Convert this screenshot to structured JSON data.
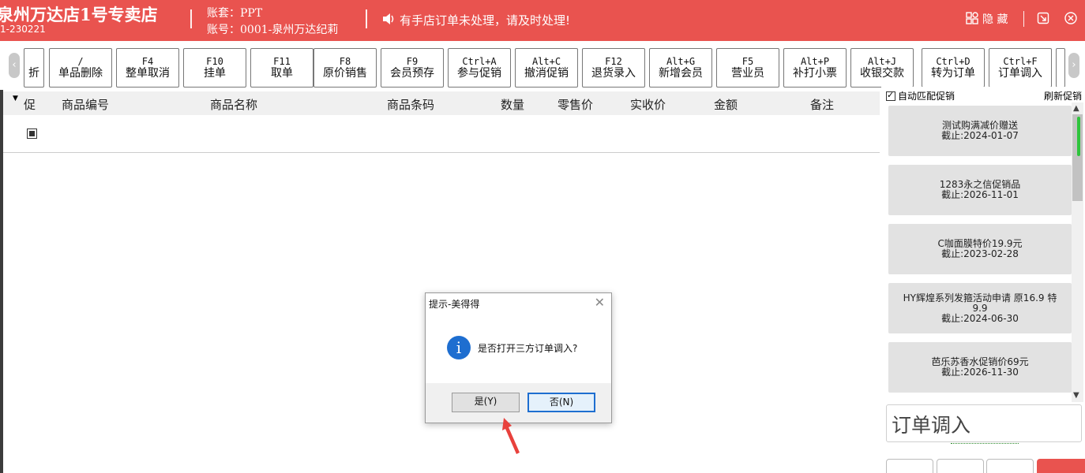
{
  "header": {
    "store_name": "泉州万达店1号专卖店",
    "store_code": "1-230221",
    "account_set": "账套：PPT",
    "account_no": "账号：0001-泉州万达纪莉",
    "notice": "有手店订单未处理，请及时处理!",
    "right_label": "隐 藏"
  },
  "toolbar": {
    "buttons": [
      {
        "key": "",
        "label": "折"
      },
      {
        "key": "/",
        "label": "单品删除"
      },
      {
        "key": "F4",
        "label": "整单取消"
      },
      {
        "key": "F10",
        "label": "挂单"
      },
      {
        "key": "F11",
        "label": "取单"
      },
      {
        "key": "F8",
        "label": "原价销售"
      },
      {
        "key": "F9",
        "label": "会员预存"
      },
      {
        "key": "Ctrl+A",
        "label": "参与促销"
      },
      {
        "key": "Alt+C",
        "label": "撤消促销"
      },
      {
        "key": "F12",
        "label": "退货录入"
      },
      {
        "key": "Alt+G",
        "label": "新增会员"
      },
      {
        "key": "F5",
        "label": "营业员"
      },
      {
        "key": "Alt+P",
        "label": "补打小票"
      },
      {
        "key": "Alt+J",
        "label": "收银交款"
      },
      {
        "key": "Ctrl+D",
        "label": "转为订单"
      },
      {
        "key": "Ctrl+F",
        "label": "订单调入"
      }
    ]
  },
  "grid": {
    "columns": [
      "促",
      "商品编号",
      "商品名称",
      "商品条码",
      "数量",
      "零售价",
      "实收价",
      "金额",
      "备注"
    ]
  },
  "promotions": {
    "auto_match_label": "自动匹配促销",
    "refresh_label": "刷新促销",
    "items": [
      {
        "name": "测试购满减价赠送",
        "expire": "截止:2024-01-07"
      },
      {
        "name": "1283永之信促销品",
        "expire": "截止:2026-11-01"
      },
      {
        "name": "C咖面膜特价19.9元",
        "expire": "截止:2023-02-28"
      },
      {
        "name": "HY辉煌系列发箍活动申请 原16.9 特",
        "name2": "9.9",
        "expire": "截止:2024-06-30"
      },
      {
        "name": "芭乐苏香水促销价69元",
        "expire": "截止:2026-11-30"
      }
    ]
  },
  "order_input": {
    "placeholder": "订单调入"
  },
  "dialog": {
    "title": "提示-美得得",
    "message": "是否打开三方订单调入?",
    "yes_label": "是(Y)",
    "no_label": "否(N)"
  },
  "colors": {
    "header_red": "#e9534f",
    "info_blue": "#1e6ed0",
    "arrow_red": "#e8413c"
  }
}
